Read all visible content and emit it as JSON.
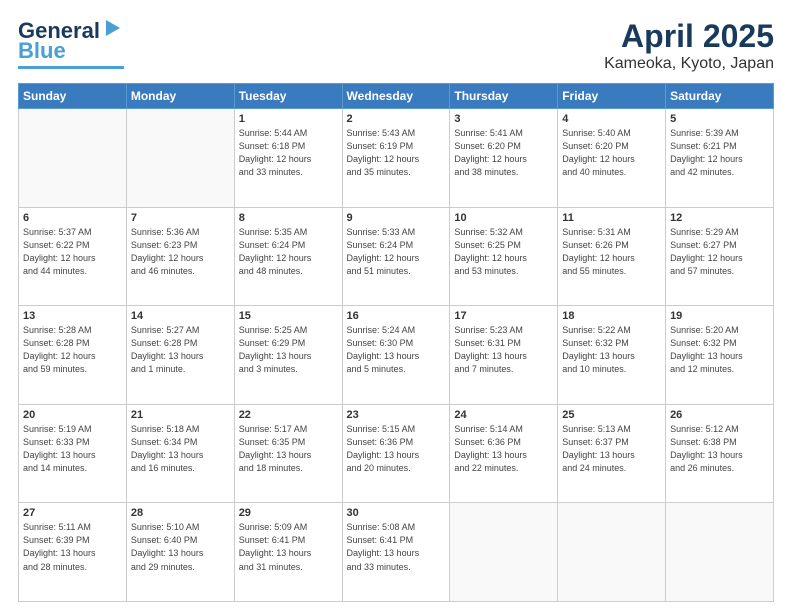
{
  "header": {
    "logo_line1": "General",
    "logo_line2": "Blue",
    "title": "April 2025",
    "subtitle": "Kameoka, Kyoto, Japan"
  },
  "calendar": {
    "headers": [
      "Sunday",
      "Monday",
      "Tuesday",
      "Wednesday",
      "Thursday",
      "Friday",
      "Saturday"
    ],
    "rows": [
      [
        {
          "day": "",
          "info": ""
        },
        {
          "day": "",
          "info": ""
        },
        {
          "day": "1",
          "info": "Sunrise: 5:44 AM\nSunset: 6:18 PM\nDaylight: 12 hours\nand 33 minutes."
        },
        {
          "day": "2",
          "info": "Sunrise: 5:43 AM\nSunset: 6:19 PM\nDaylight: 12 hours\nand 35 minutes."
        },
        {
          "day": "3",
          "info": "Sunrise: 5:41 AM\nSunset: 6:20 PM\nDaylight: 12 hours\nand 38 minutes."
        },
        {
          "day": "4",
          "info": "Sunrise: 5:40 AM\nSunset: 6:20 PM\nDaylight: 12 hours\nand 40 minutes."
        },
        {
          "day": "5",
          "info": "Sunrise: 5:39 AM\nSunset: 6:21 PM\nDaylight: 12 hours\nand 42 minutes."
        }
      ],
      [
        {
          "day": "6",
          "info": "Sunrise: 5:37 AM\nSunset: 6:22 PM\nDaylight: 12 hours\nand 44 minutes."
        },
        {
          "day": "7",
          "info": "Sunrise: 5:36 AM\nSunset: 6:23 PM\nDaylight: 12 hours\nand 46 minutes."
        },
        {
          "day": "8",
          "info": "Sunrise: 5:35 AM\nSunset: 6:24 PM\nDaylight: 12 hours\nand 48 minutes."
        },
        {
          "day": "9",
          "info": "Sunrise: 5:33 AM\nSunset: 6:24 PM\nDaylight: 12 hours\nand 51 minutes."
        },
        {
          "day": "10",
          "info": "Sunrise: 5:32 AM\nSunset: 6:25 PM\nDaylight: 12 hours\nand 53 minutes."
        },
        {
          "day": "11",
          "info": "Sunrise: 5:31 AM\nSunset: 6:26 PM\nDaylight: 12 hours\nand 55 minutes."
        },
        {
          "day": "12",
          "info": "Sunrise: 5:29 AM\nSunset: 6:27 PM\nDaylight: 12 hours\nand 57 minutes."
        }
      ],
      [
        {
          "day": "13",
          "info": "Sunrise: 5:28 AM\nSunset: 6:28 PM\nDaylight: 12 hours\nand 59 minutes."
        },
        {
          "day": "14",
          "info": "Sunrise: 5:27 AM\nSunset: 6:28 PM\nDaylight: 13 hours\nand 1 minute."
        },
        {
          "day": "15",
          "info": "Sunrise: 5:25 AM\nSunset: 6:29 PM\nDaylight: 13 hours\nand 3 minutes."
        },
        {
          "day": "16",
          "info": "Sunrise: 5:24 AM\nSunset: 6:30 PM\nDaylight: 13 hours\nand 5 minutes."
        },
        {
          "day": "17",
          "info": "Sunrise: 5:23 AM\nSunset: 6:31 PM\nDaylight: 13 hours\nand 7 minutes."
        },
        {
          "day": "18",
          "info": "Sunrise: 5:22 AM\nSunset: 6:32 PM\nDaylight: 13 hours\nand 10 minutes."
        },
        {
          "day": "19",
          "info": "Sunrise: 5:20 AM\nSunset: 6:32 PM\nDaylight: 13 hours\nand 12 minutes."
        }
      ],
      [
        {
          "day": "20",
          "info": "Sunrise: 5:19 AM\nSunset: 6:33 PM\nDaylight: 13 hours\nand 14 minutes."
        },
        {
          "day": "21",
          "info": "Sunrise: 5:18 AM\nSunset: 6:34 PM\nDaylight: 13 hours\nand 16 minutes."
        },
        {
          "day": "22",
          "info": "Sunrise: 5:17 AM\nSunset: 6:35 PM\nDaylight: 13 hours\nand 18 minutes."
        },
        {
          "day": "23",
          "info": "Sunrise: 5:15 AM\nSunset: 6:36 PM\nDaylight: 13 hours\nand 20 minutes."
        },
        {
          "day": "24",
          "info": "Sunrise: 5:14 AM\nSunset: 6:36 PM\nDaylight: 13 hours\nand 22 minutes."
        },
        {
          "day": "25",
          "info": "Sunrise: 5:13 AM\nSunset: 6:37 PM\nDaylight: 13 hours\nand 24 minutes."
        },
        {
          "day": "26",
          "info": "Sunrise: 5:12 AM\nSunset: 6:38 PM\nDaylight: 13 hours\nand 26 minutes."
        }
      ],
      [
        {
          "day": "27",
          "info": "Sunrise: 5:11 AM\nSunset: 6:39 PM\nDaylight: 13 hours\nand 28 minutes."
        },
        {
          "day": "28",
          "info": "Sunrise: 5:10 AM\nSunset: 6:40 PM\nDaylight: 13 hours\nand 29 minutes."
        },
        {
          "day": "29",
          "info": "Sunrise: 5:09 AM\nSunset: 6:41 PM\nDaylight: 13 hours\nand 31 minutes."
        },
        {
          "day": "30",
          "info": "Sunrise: 5:08 AM\nSunset: 6:41 PM\nDaylight: 13 hours\nand 33 minutes."
        },
        {
          "day": "",
          "info": ""
        },
        {
          "day": "",
          "info": ""
        },
        {
          "day": "",
          "info": ""
        }
      ]
    ]
  }
}
